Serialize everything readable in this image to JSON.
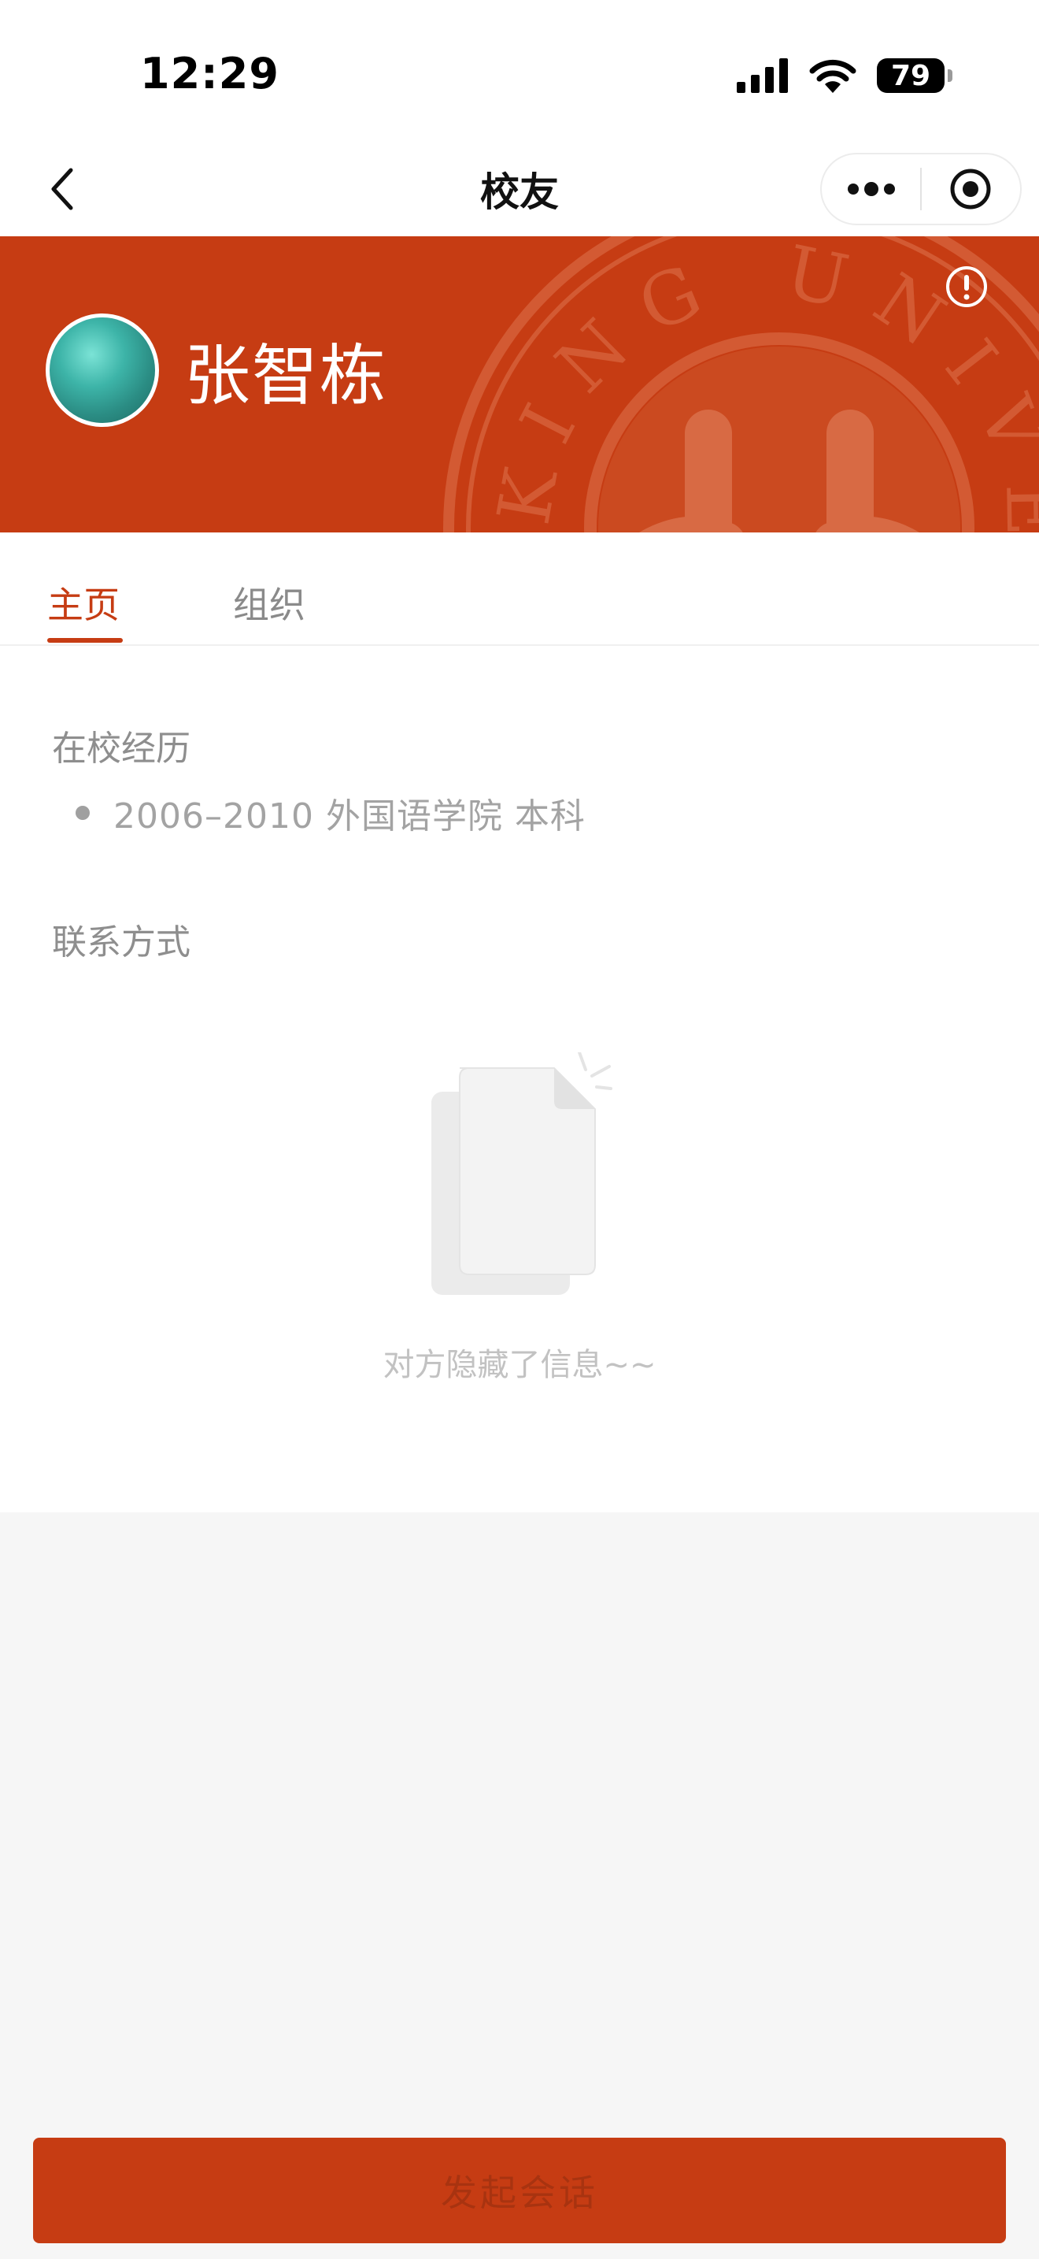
{
  "status_bar": {
    "time": "12:29",
    "battery": "79",
    "icons": [
      "cellular-signal-icon",
      "wifi-icon",
      "battery-icon"
    ]
  },
  "nav": {
    "title": "校友",
    "back_icon": "chevron-left-icon",
    "capsule_icons": [
      "more-dots-icon",
      "close-target-icon"
    ]
  },
  "profile": {
    "name": "张智栋",
    "header_color": "#c63c13",
    "emblem_text": "KING UNIVERS",
    "info_icon": "exclamation-circle-icon"
  },
  "tabs": [
    {
      "label": "主页",
      "active": true
    },
    {
      "label": "组织",
      "active": false
    }
  ],
  "sections": {
    "education_title": "在校经历",
    "education_items": [
      "2006–2010 外国语学院 本科"
    ],
    "contact_title": "联系方式",
    "contact_empty_text": "对方隐藏了信息~~"
  },
  "bottom_button": {
    "label": "发起会话"
  },
  "colors": {
    "accent": "#c63c13",
    "muted_text": "#8e8e8e",
    "background": "#f6f6f6"
  }
}
